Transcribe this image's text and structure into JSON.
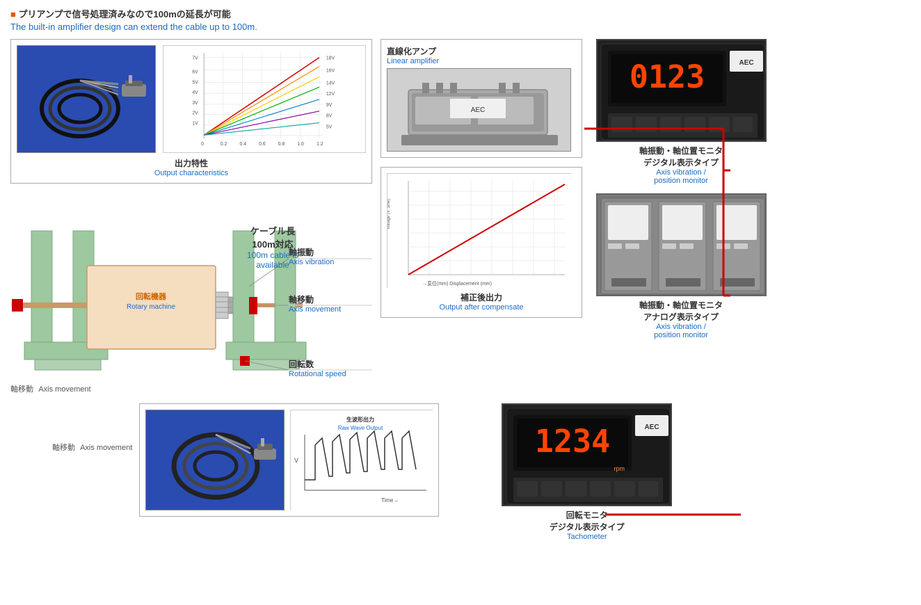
{
  "header": {
    "jp": "プリアンプで信号処理済みなので100mの延長が可能",
    "en": "The built-in amplifier design can extend the cable up to 100m."
  },
  "sensor_chart": {
    "title_jp": "出力特性",
    "title_en": "Output characteristics"
  },
  "cable_box": {
    "jp_line1": "ケーブル長",
    "jp_line2": "100m対応",
    "en_line1": "100m cable is",
    "en_line2": "available"
  },
  "linear_amp": {
    "title_jp": "直線化アンプ",
    "title_en": "Linear amplifier"
  },
  "output_after": {
    "title_jp": "補正後出力",
    "title_en": "Output after compensate"
  },
  "axis_vibration": {
    "jp": "軸振動",
    "en": "Axis vibration"
  },
  "axis_movement_top": {
    "jp": "軸移動",
    "en": "Axis movement"
  },
  "rotational_speed": {
    "jp": "回転数",
    "en": "Rotational speed"
  },
  "rotary_machine": {
    "jp": "回転機器",
    "en": "Rotary machine"
  },
  "axis_movement_bottom": {
    "jp": "軸移動",
    "en": "Axis movement"
  },
  "monitor1": {
    "title_jp_line1": "軸振動・軸位置モニタ",
    "title_jp_line2": "デジタル表示タイプ",
    "title_en_line1": "Axis vibration /",
    "title_en_line2": "position monitor",
    "display": "0123"
  },
  "monitor2": {
    "title_jp_line1": "軸振動・軸位置モニタ",
    "title_jp_line2": "アナログ表示タイプ",
    "title_en_line1": "Axis vibration /",
    "title_en_line2": "position monitor"
  },
  "monitor3": {
    "title_jp_line1": "回転モニタ",
    "title_jp_line2": "デジタル表示タイプ",
    "title_en": "Tachometer",
    "display": "1234"
  },
  "raw_wave": {
    "title_jp": "生波形出力",
    "title_en": "Raw Wave Output"
  },
  "chart_y_labels": [
    "7V",
    "6V",
    "5V",
    "4V",
    "3V",
    "2V",
    "1V"
  ],
  "chart_x_labels": [
    "0.0",
    "0.2",
    "0.4",
    "0.6",
    "0.8",
    "1.0",
    "1.2"
  ],
  "chart_v_labels": [
    "18V",
    "16V",
    "14V",
    "12V",
    "9V",
    "8V",
    "5V"
  ],
  "output_chart_x_label": "→変位(mm) Displacement (mm)",
  "output_chart_y_label": "Voltage (V, 3me)"
}
